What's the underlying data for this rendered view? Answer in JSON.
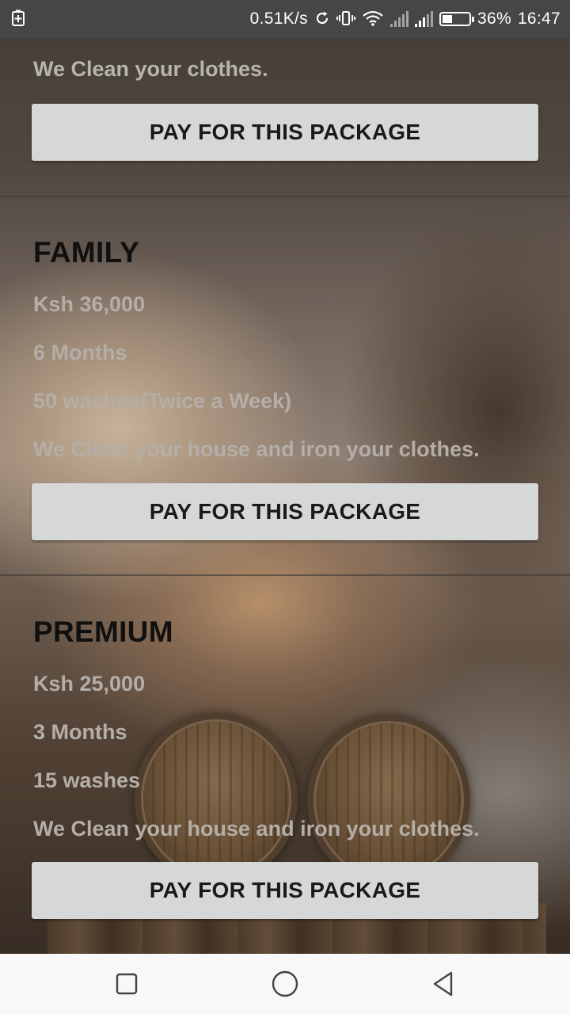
{
  "status_bar": {
    "network_speed": "0.51K/s",
    "battery_percent": "36%",
    "battery_level": 0.36,
    "time": "16:47"
  },
  "top_package": {
    "description": "We Clean your clothes.",
    "pay_label": "PAY FOR THIS PACKAGE"
  },
  "packages": [
    {
      "title": "FAMILY",
      "price": "Ksh 36,000",
      "duration": "6 Months",
      "washes": "50 washes(Twice a Week)",
      "description": "We Clean your house and iron your clothes.",
      "pay_label": "PAY FOR THIS PACKAGE"
    },
    {
      "title": "PREMIUM",
      "price": "Ksh 25,000",
      "duration": "3 Months",
      "washes": "15 washes",
      "description": "We Clean your house and iron your clothes.",
      "pay_label": "PAY FOR THIS PACKAGE"
    }
  ],
  "nav_bar": {
    "icons": [
      "recents-square-icon",
      "home-circle-icon",
      "back-triangle-icon"
    ]
  }
}
